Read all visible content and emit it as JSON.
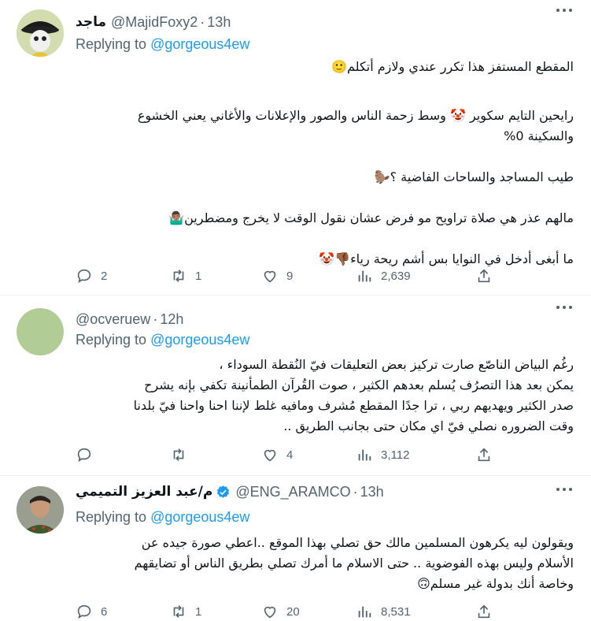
{
  "replying_prefix": "Replying to",
  "tweets": [
    {
      "name": "ماجد",
      "handle": "@MajidFoxy2",
      "time": "13h",
      "reply_to": "@gorgeous4ew",
      "lines": [
        "المقطع المستفز هذا تكرر عندي ولازم أتكلم🙂",
        "",
        "رايحين التايم سكوير 🤡 وسط زحمة الناس والصور والإعلانات والأغاني يعني الخشوع",
        "والسكينة 0%",
        "",
        "طيب المساجد والساحات الفاضية ؟🦫",
        "",
        "مالهم عذر هي صلاة تراويح مو فرض عشان نقول الوقت لا يخرج ومضطرين🤷🏽‍♂️",
        "",
        "ما أبغى أدخل في النوايا بس أشم ريحة رياء👎🏾🤡"
      ],
      "stats": {
        "replies": "2",
        "retweets": "1",
        "likes": "9",
        "views": "2,639"
      }
    },
    {
      "name": "",
      "handle": "@ocveruew",
      "time": "12h",
      "reply_to": "@gorgeous4ew",
      "lines": [
        "رغُم البياض الناصّع صارت تركيز بعض التعليقات فيّ النُقطة السوداء ،",
        "يمكن بعد هذا التصرُف يُسلم بعدهم الكثير ، صوت القُرآن الطمأنينة تكفي بإنه يشرح",
        "صدر الكثير ويهديهم ربي ، ترا جدًا المقطع مُشرف ومافيه غلط لإننا احنا واحنا فيّ بلدنا",
        "وقت الضروره نصلي فيّ اي مكان حتى بجانب الطريق .."
      ],
      "stats": {
        "replies": "",
        "retweets": "",
        "likes": "4",
        "views": "3,112"
      }
    },
    {
      "name": "م/عبد العزيز التميمي",
      "handle": "@ENG_ARAMCO",
      "time": "13h",
      "reply_to": "@gorgeous4ew",
      "lines": [
        "ويقولون ليه يكرهون المسلمين مالك حق تصلي بهذا الموقع ..اعطي صورة جيده عن",
        "الأسلام وليس بهذه الفوضوية .. حتى الاسلام ما أمرك تصلي بطريق الناس أو تضايقهم",
        "وخاصة أنك بدولة غير مسلم🙃"
      ],
      "stats": {
        "replies": "6",
        "retweets": "1",
        "likes": "20",
        "views": "8,531"
      }
    }
  ],
  "icons": {
    "reply": "comment-icon",
    "retweet": "retweet-icon",
    "like": "heart-icon",
    "views": "views-icon",
    "share": "share-icon",
    "more": "more-icon",
    "verified": "verified-badge-icon"
  },
  "colors": {
    "link": "#1d9bf0",
    "muted": "#536471",
    "verified": "#1d9bf0"
  }
}
